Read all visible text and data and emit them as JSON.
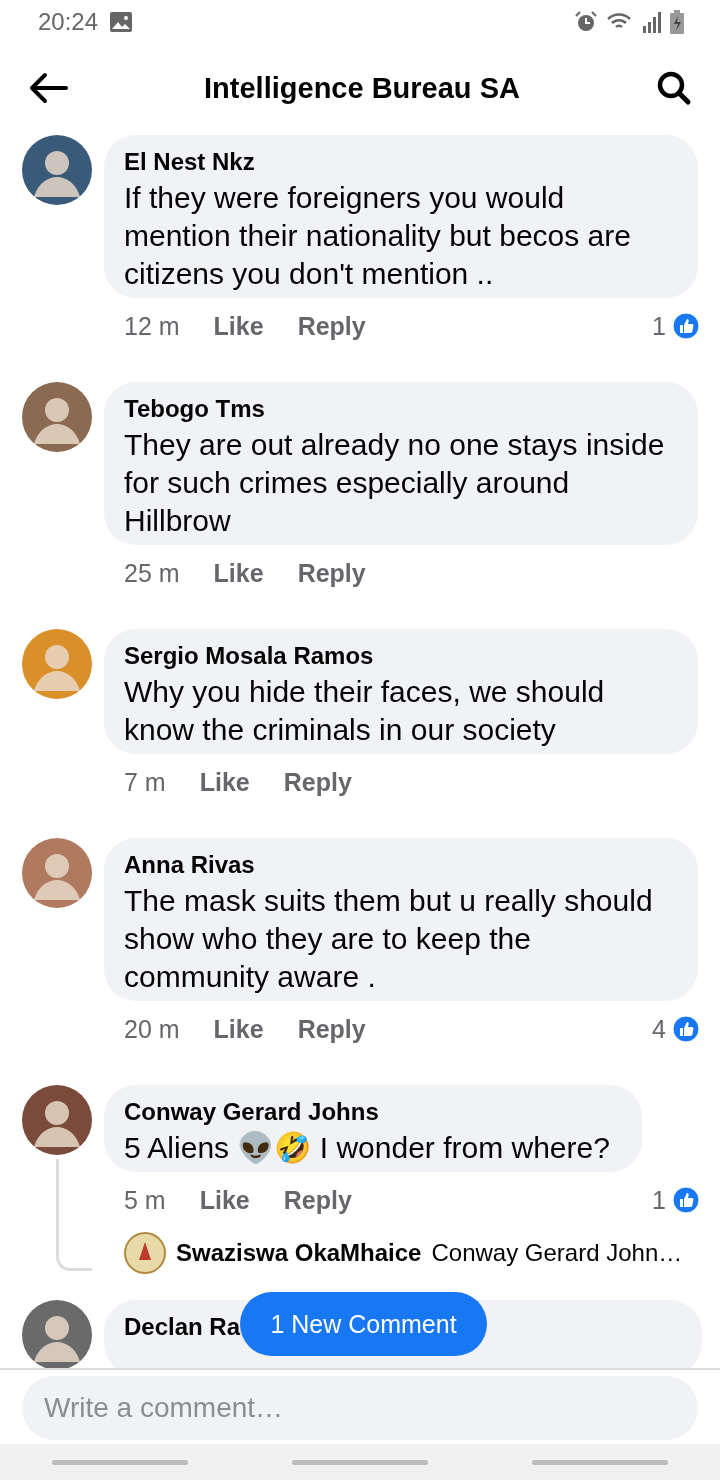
{
  "status_bar": {
    "time": "20:24"
  },
  "header": {
    "title": "Intelligence Bureau SA"
  },
  "comments": [
    {
      "author": "El Nest Nkz",
      "text": "If they were foreigners you would mention their nationality but becos are citizens you don't mention ..",
      "time": "12 m",
      "like": "Like",
      "reply": "Reply",
      "likes": "1"
    },
    {
      "author": "Tebogo Tms",
      "text": "They are out already no one stays inside for such crimes especially around Hillbrow",
      "time": "25 m",
      "like": "Like",
      "reply": "Reply"
    },
    {
      "author": "Sergio Mosala Ramos",
      "text": "Why you hide their faces, we should know the criminals in our society",
      "time": "7 m",
      "like": "Like",
      "reply": "Reply"
    },
    {
      "author": "Anna Rivas",
      "text": "The mask suits them but u really should show who they are to keep the community  aware .",
      "time": "20 m",
      "like": "Like",
      "reply": "Reply",
      "likes": "4"
    },
    {
      "author": "Conway Gerard Johns",
      "text": "5 Aliens 👽🤣 I wonder from where?",
      "time": "5 m",
      "like": "Like",
      "reply": "Reply",
      "likes": "1",
      "replies": [
        {
          "author": "Swaziswa OkaMhaice",
          "text": "Conway Gerard John…"
        }
      ]
    },
    {
      "author": "Declan Ra"
    }
  ],
  "new_comment_button": "1 New Comment",
  "composer": {
    "placeholder": "Write a comment…"
  }
}
